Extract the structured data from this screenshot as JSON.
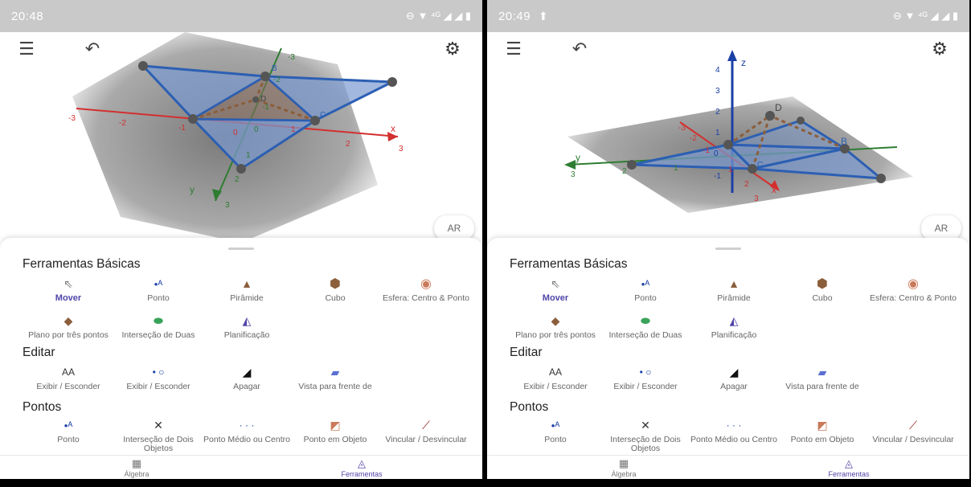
{
  "screens": [
    {
      "status": {
        "time": "20:48",
        "sys_icons": "⊖ ▼ ⁴ᴳ ◢ ◢ ▮",
        "upload": ""
      },
      "ar_label": "AR",
      "sections": [
        {
          "title": "Ferramentas Básicas",
          "tools": [
            "Mover",
            "Ponto",
            "Pirâmide",
            "Cubo",
            "Esfera: Centro & Ponto",
            "Plano por três pontos",
            "Interseção de Duas",
            "Planificação"
          ]
        },
        {
          "title": "Editar",
          "tools": [
            "Exibir / Esconder",
            "Exibir / Esconder",
            "Apagar",
            "Vista para frente de"
          ]
        },
        {
          "title": "Pontos",
          "tools": [
            "Ponto",
            "Interseção de Dois Objetos",
            "Ponto Médio ou Centro",
            "Ponto em Objeto",
            "Vincular / Desvincular"
          ]
        }
      ],
      "nav": {
        "algebra": "Álgebra",
        "tools": "Ferramentas"
      },
      "graph": {
        "x_ticks": [
          "-3",
          "-2",
          "-1",
          "0",
          "1",
          "2",
          "3"
        ],
        "y_ticks": [
          "-3",
          "-2",
          "-1",
          "0",
          "1",
          "2",
          "3"
        ],
        "axis_x": "x",
        "axis_y": "y",
        "points": [
          "B",
          "C",
          "D"
        ]
      }
    },
    {
      "status": {
        "time": "20:49",
        "sys_icons": "⊖ ▼ ⁴ᴳ ◢ ◢ ▮",
        "upload": "⬆"
      },
      "ar_label": "AR",
      "sections": [
        {
          "title": "Ferramentas Básicas",
          "tools": [
            "Mover",
            "Ponto",
            "Pirâmide",
            "Cubo",
            "Esfera: Centro & Ponto",
            "Plano por três pontos",
            "Interseção de Duas",
            "Planificação"
          ]
        },
        {
          "title": "Editar",
          "tools": [
            "Exibir / Esconder",
            "Exibir / Esconder",
            "Apagar",
            "Vista para frente de"
          ]
        },
        {
          "title": "Pontos",
          "tools": [
            "Ponto",
            "Interseção de Dois Objetos",
            "Ponto Médio ou Centro",
            "Ponto em Objeto",
            "Vincular / Desvincular"
          ]
        }
      ],
      "nav": {
        "algebra": "Álgebra",
        "tools": "Ferramentas"
      },
      "graph": {
        "z_ticks": [
          "-1",
          "0",
          "1",
          "2",
          "3",
          "4"
        ],
        "x_ticks": [
          "-3",
          "-2",
          "-1",
          "1",
          "2",
          "3"
        ],
        "y_ticks": [
          "1",
          "2",
          "3"
        ],
        "axis_x": "x",
        "axis_y": "y",
        "axis_z": "z",
        "points": [
          "B",
          "C",
          "D"
        ]
      }
    }
  ],
  "colors": {
    "accent": "#5145a8",
    "polygon": "#6e8fc8",
    "pyramid": "#8b5e3c",
    "x_axis": "#d32f2f",
    "y_axis": "#2e7d32",
    "z_axis": "#1a3fa6"
  }
}
